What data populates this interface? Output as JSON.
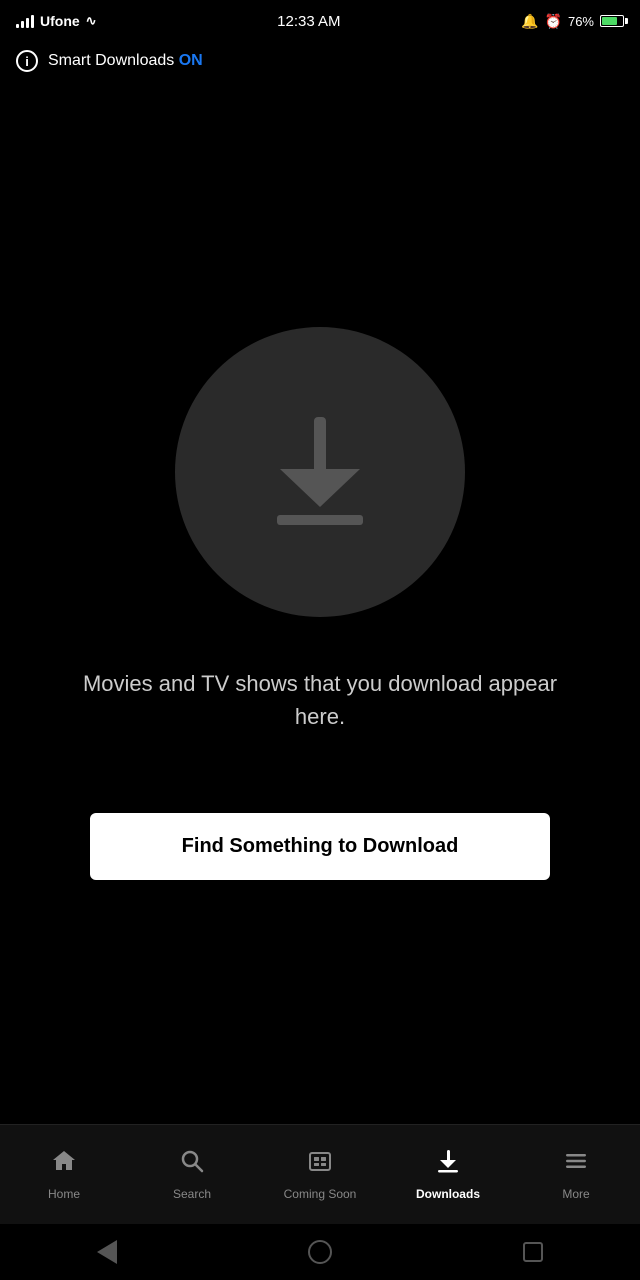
{
  "statusBar": {
    "carrier": "Ufone",
    "time": "12:33 AM",
    "battery": "76%",
    "batteryColor": "#4CD964"
  },
  "smartDownloads": {
    "label": "Smart Downloads",
    "statusLabel": "ON",
    "infoIcon": "i"
  },
  "mainContent": {
    "descriptionText": "Movies and TV shows that you download appear here.",
    "findButtonLabel": "Find Something to Download"
  },
  "bottomNav": {
    "items": [
      {
        "id": "home",
        "label": "Home",
        "icon": "home",
        "active": false
      },
      {
        "id": "search",
        "label": "Search",
        "icon": "search",
        "active": false
      },
      {
        "id": "coming-soon",
        "label": "Coming Soon",
        "icon": "coming-soon",
        "active": false
      },
      {
        "id": "downloads",
        "label": "Downloads",
        "icon": "download",
        "active": true
      },
      {
        "id": "more",
        "label": "More",
        "icon": "menu",
        "active": false
      }
    ]
  }
}
